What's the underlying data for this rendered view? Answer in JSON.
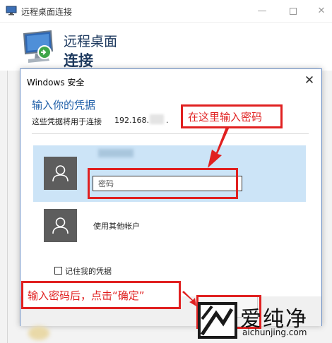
{
  "window": {
    "title": "远程桌面连接",
    "header_line1": "远程桌面",
    "header_line2": "连接",
    "controls": {
      "minimize": "—",
      "close": "✕"
    }
  },
  "dialog": {
    "title": "Windows 安全",
    "close_glyph": "✕",
    "heading": "输入你的凭据",
    "subtitle_label": "这些凭据将用于连接",
    "subtitle_ip": "192.168.",
    "subtitle_dot": ".",
    "password_placeholder": "密码",
    "other_account_label": "使用其他帐户",
    "remember_label": "记住我的凭据"
  },
  "annotations": {
    "enter_password_hint": "在这里输入密码",
    "confirm_hint": "输入密码后，点击“确定”"
  },
  "watermark": {
    "name_cn": "爱纯净",
    "domain": "aichunjing.com"
  },
  "colors": {
    "accent_blue": "#1f5fa8",
    "selected_bg": "#cce4f7",
    "annotation_red": "#e02020",
    "avatar_gray": "#5d5d5d"
  }
}
